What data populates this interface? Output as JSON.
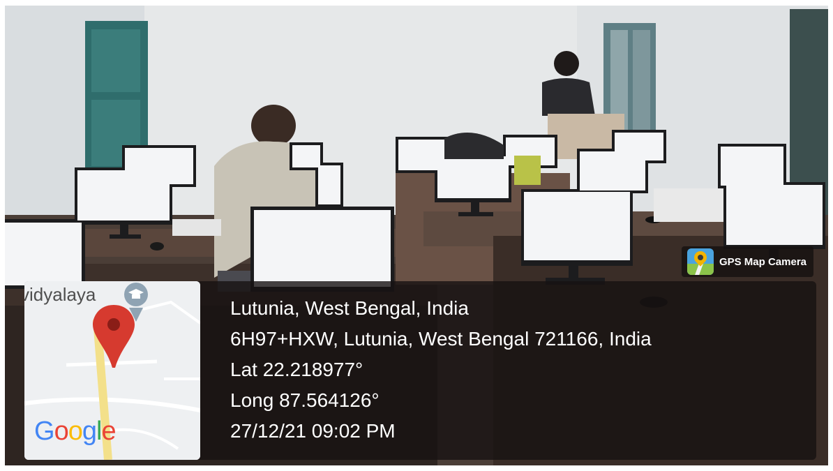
{
  "overlay": {
    "brand": {
      "label": "GPS Map Camera",
      "icon": "gps-map-camera-app-icon"
    },
    "map": {
      "place_label": "vidyalaya",
      "logo_text": "Google",
      "pin_icon": "map-pin-icon",
      "poi_icon": "school-icon"
    },
    "location": {
      "place": "Lutunia, West Bengal, India",
      "address": "6H97+HXW, Lutunia, West Bengal 721166, India",
      "latitude": "Lat 22.218977°",
      "longitude": "Long 87.564126°",
      "datetime": "27/12/21 09:02 PM"
    }
  },
  "colors": {
    "panel_bg": "#161212",
    "pin_red": "#d63a2f",
    "road_yellow": "#f3e08a",
    "google_blue": "#4285F4",
    "google_red": "#EA4335",
    "google_yellow": "#FBBC05",
    "google_green": "#34A853"
  }
}
